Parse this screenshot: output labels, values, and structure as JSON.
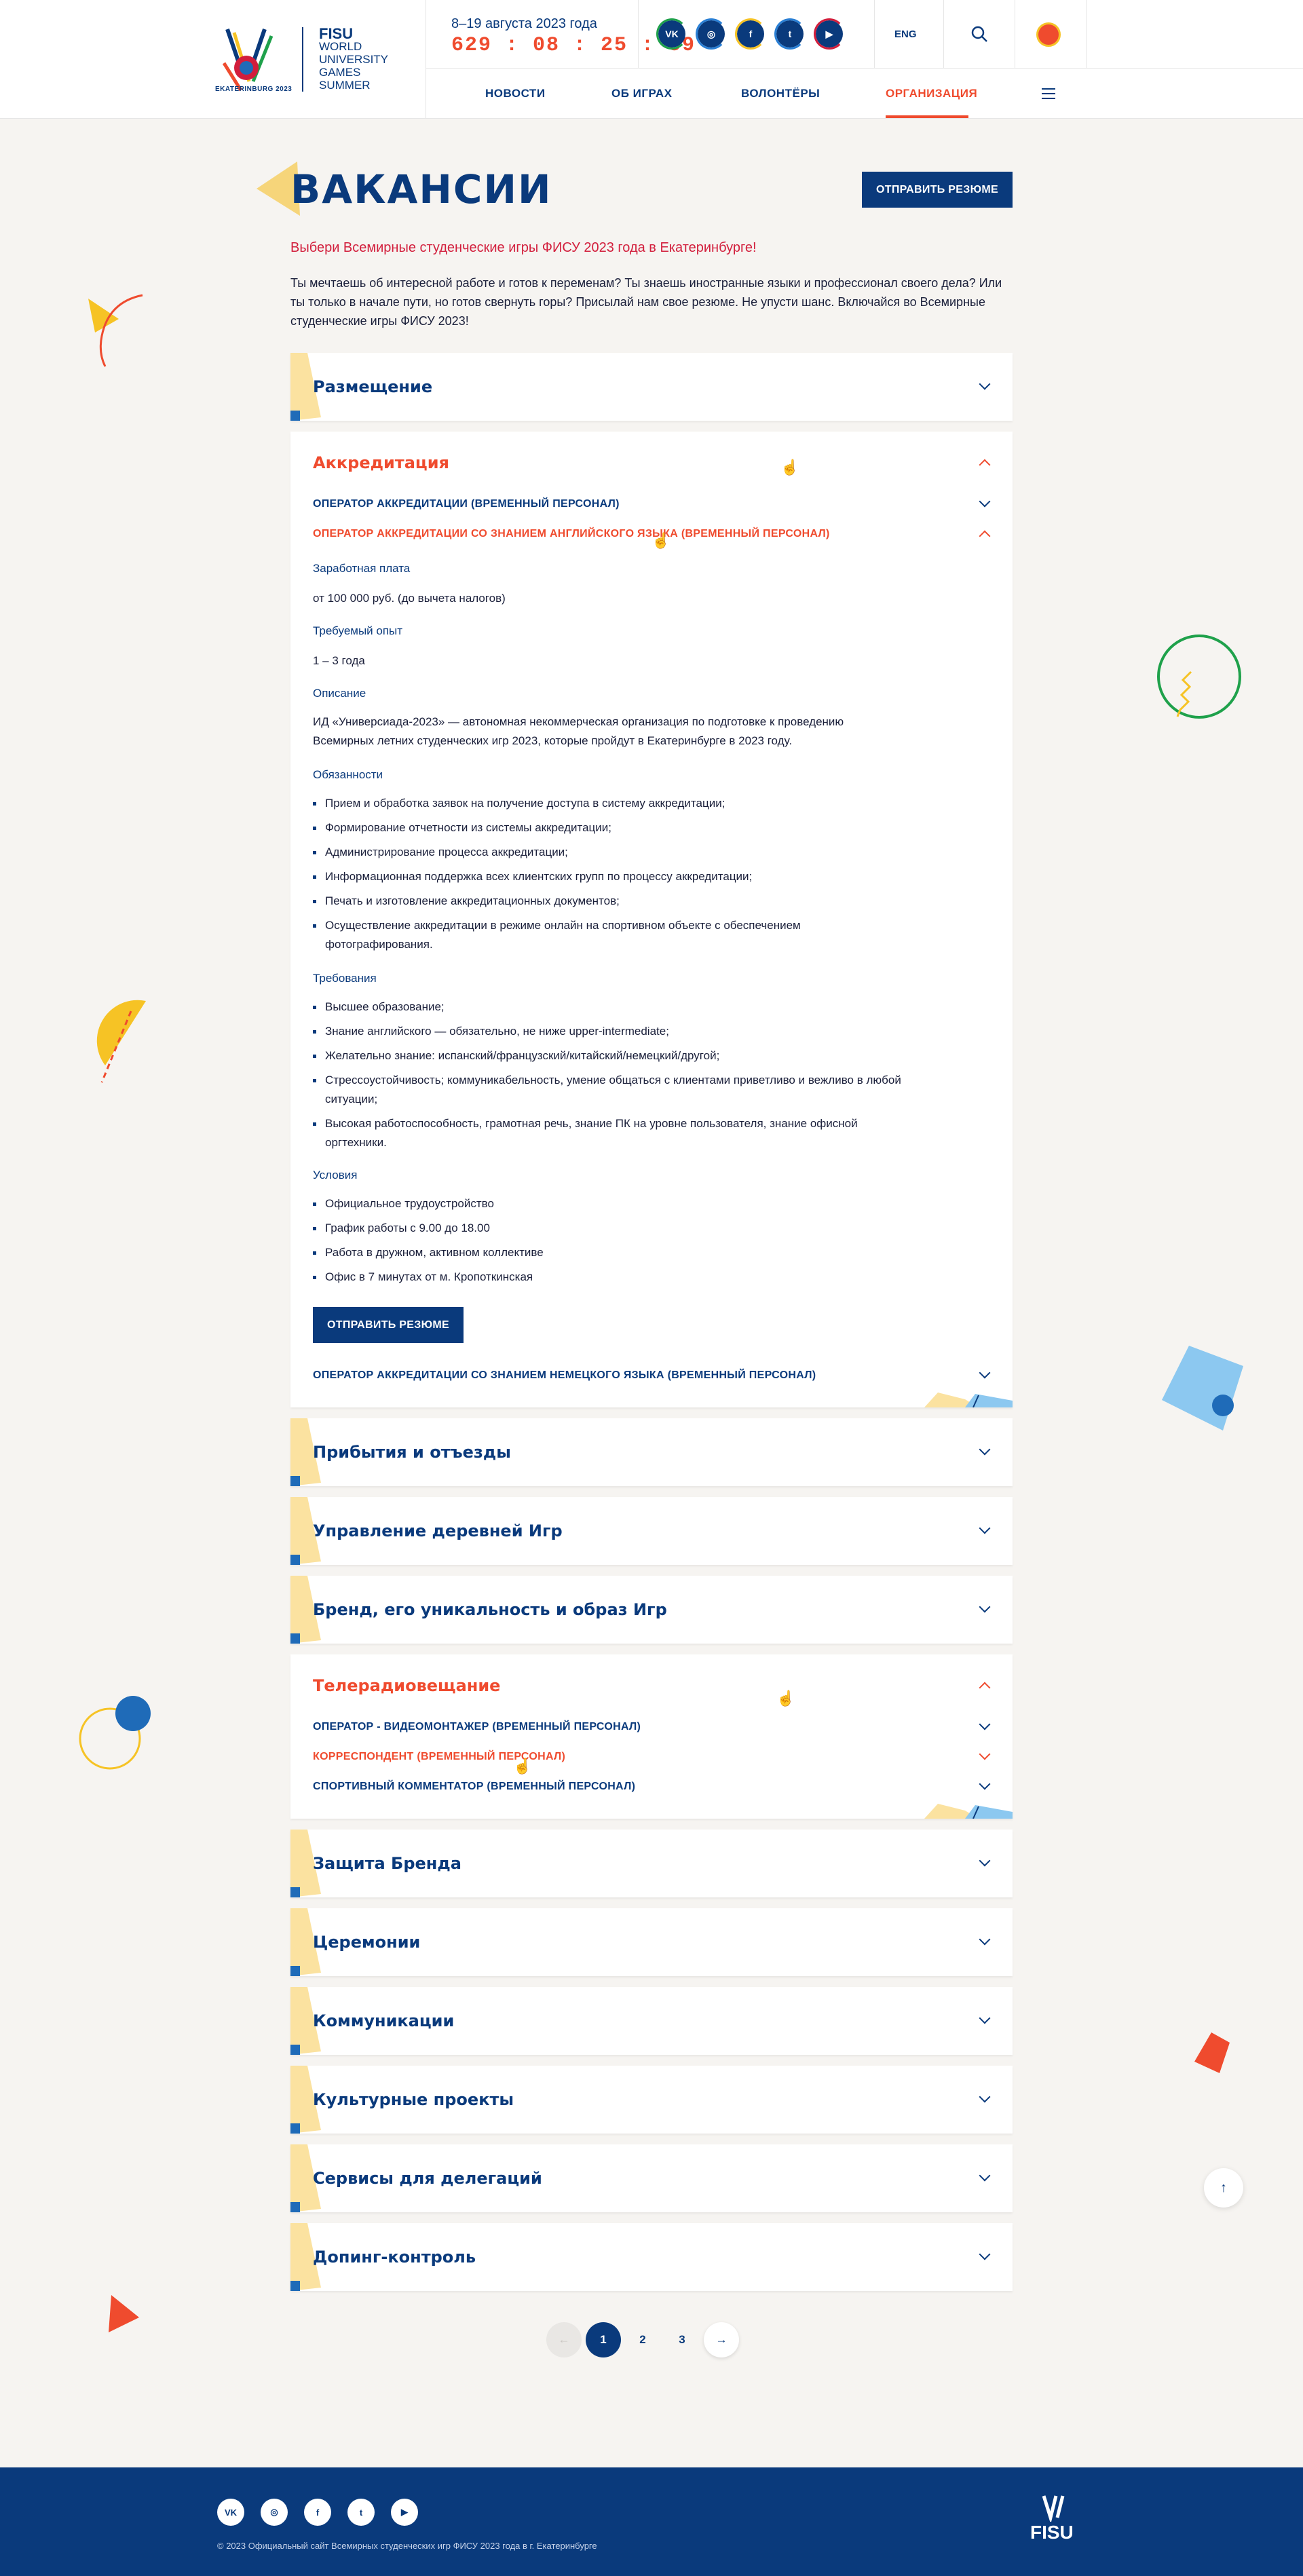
{
  "header": {
    "logo": {
      "brand": "FISU",
      "line1": "WORLD",
      "line2": "UNIVERSITY",
      "line3": "GAMES",
      "line4": "SUMMER",
      "city": "EKATERINBURG 2023"
    },
    "dates": "8–19 августа 2023 года",
    "countdown": "629 : 08 : 25 : 59",
    "socials": [
      {
        "icon": "vk-icon",
        "text": "VK",
        "color": "#0a3a7c",
        "ring": "#1fa14b"
      },
      {
        "icon": "instagram-icon",
        "text": "◎",
        "color": "#0a3a7c",
        "ring": "#2a7fd4"
      },
      {
        "icon": "facebook-icon",
        "text": "f",
        "color": "#0a3a7c",
        "ring": "#f6c325"
      },
      {
        "icon": "twitter-icon",
        "text": "t",
        "color": "#0a3a7c",
        "ring": "#2a7fd4"
      },
      {
        "icon": "youtube-icon",
        "text": "▶",
        "color": "#0a3a7c",
        "ring": "#d21e3c"
      }
    ],
    "lang": "ENG",
    "nav": [
      {
        "label": "НОВОСТИ",
        "active": false
      },
      {
        "label": "ОБ ИГРАХ",
        "active": false
      },
      {
        "label": "ВОЛОНТЁРЫ",
        "active": false
      },
      {
        "label": "ОРГАНИЗАЦИЯ",
        "active": true
      }
    ]
  },
  "page": {
    "title": "ВАКАНСИИ",
    "send_resume": "ОТПРАВИТЬ РЕЗЮМЕ",
    "lead": "Выбери Всемирные студенческие игры ФИСУ 2023 года в Екатеринбурге!",
    "intro": "Ты мечтаешь об интересной работе и готов к переменам? Ты знаешь иностранные языки и профессионал своего дела? Или ты только в начале пути, но готов свернуть горы? Присылай нам свое резюме. Не упусти шанс. Включайся во Всемирные студенческие игры ФИСУ 2023!"
  },
  "categories": {
    "razmeshchenie": "Размещение",
    "akkreditatsiya": "Аккредитация",
    "pribytiya": "Прибытия и отъезды",
    "derevnya": "Управление деревней Игр",
    "brand": "Бренд, его уникальность и образ Игр",
    "teleradio": "Телерадиовещание",
    "zashchita": "Защита Бренда",
    "ceremonii": "Церемонии",
    "kommunikatsii": "Коммуникации",
    "kultura": "Культурные проекты",
    "servisy": "Сервисы для делегаций",
    "doping": "Допинг-контроль"
  },
  "accreditation": {
    "jobs": [
      "ОПЕРАТОР АККРЕДИТАЦИИ (ВРЕМЕННЫЙ ПЕРСОНАЛ)",
      "ОПЕРАТОР АККРЕДИТАЦИИ СО ЗНАНИЕМ АНГЛИЙСКОГО ЯЗЫКА (ВРЕМЕННЫЙ ПЕРСОНАЛ)",
      "ОПЕРАТОР АККРЕДИТАЦИИ СО ЗНАНИЕМ НЕМЕЦКОГО ЯЗЫКА (ВРЕМЕННЫЙ ПЕРСОНАЛ)"
    ],
    "salary_label": "Заработная плата",
    "salary": "от 100 000 руб. (до вычета налогов)",
    "exp_label": "Требуемый опыт",
    "exp": "1 – 3 года",
    "desc_label": "Описание",
    "desc": "ИД «Универсиада-2023» — автономная некоммерческая организация по подготовке к проведению Всемирных летних студенческих игр 2023, которые пройдут в Екатеринбурге в 2023 году.",
    "duties_label": "Обязанности",
    "duties": [
      "Прием и обработка заявок на получение доступа в систему аккредитации;",
      "Формирование отчетности из системы аккредитации;",
      "Администрирование процесса аккредитации;",
      "Информационная поддержка всех клиентских групп по процессу аккредитации;",
      "Печать и изготовление аккредитационных документов;",
      "Осуществление аккредитации в режиме онлайн на спортивном объекте с обеспечением фотографирования."
    ],
    "req_label": "Требования",
    "requirements": [
      "Высшее образование;",
      "Знание английского — обязательно, не ниже upper-intermediate;",
      "Желательно знание: испанский/французский/китайский/немецкий/другой;",
      "Стрессоустойчивость; коммуникабельность, умение общаться с клиентами приветливо и вежливо в любой ситуации;",
      "Высокая работоспособность, грамотная речь, знание ПК на уровне пользователя, знание офисной оргтехники."
    ],
    "cond_label": "Условия",
    "conditions": [
      "Официальное трудоустройство",
      "График работы с 9.00 до 18.00",
      "Работа в дружном, активном коллективе",
      "Офис в 7 минутах от м. Кропоткинская"
    ],
    "send": "ОТПРАВИТЬ РЕЗЮМЕ"
  },
  "tv_jobs": [
    "ОПЕРАТОР - ВИДЕОМОНТАЖЕР (ВРЕМЕННЫЙ ПЕРСОНАЛ)",
    "КОРРЕСПОНДЕНТ (ВРЕМЕННЫЙ ПЕРСОНАЛ)",
    "СПОРТИВНЫЙ КОММЕНТАТОР (ВРЕМЕННЫЙ ПЕРСОНАЛ)"
  ],
  "pagination": {
    "prev": "←",
    "pages": [
      "1",
      "2",
      "3"
    ],
    "next": "→",
    "current": "1"
  },
  "to_top": "↑",
  "footer": {
    "socials": [
      {
        "icon": "vk-icon",
        "text": "VK"
      },
      {
        "icon": "instagram-icon",
        "text": "◎"
      },
      {
        "icon": "facebook-icon",
        "text": "f"
      },
      {
        "icon": "twitter-icon",
        "text": "t"
      },
      {
        "icon": "youtube-icon",
        "text": "▶"
      }
    ],
    "copyright": "© 2023 Официальный сайт Всемирных студенческих игр ФИСУ 2023 года в г. Екатеринбурге",
    "logo": "FISU"
  },
  "colors": {
    "navy": "#0a3a7c",
    "accent": "#ef4b2e",
    "red": "#d21e3c",
    "yellow": "#f6c325",
    "bg": "#f6f4f1"
  }
}
